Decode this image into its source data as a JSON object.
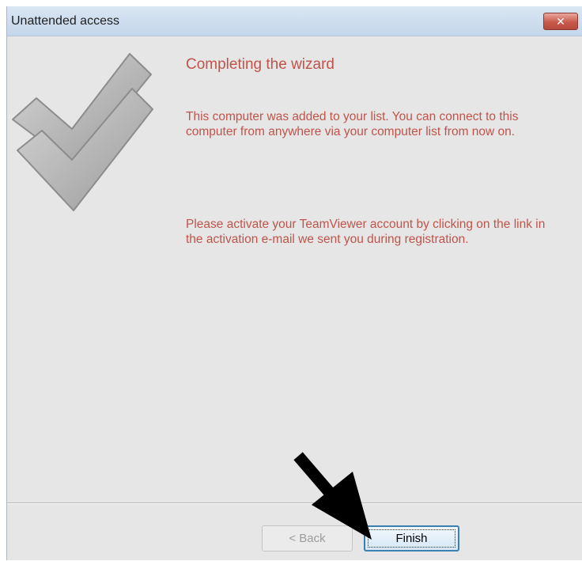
{
  "window": {
    "title": "Unattended access",
    "close_glyph": "✕"
  },
  "main": {
    "heading": "Completing the wizard",
    "paragraph_1": "This computer was added to your list. You can connect to this computer from anywhere via your computer list from now on.",
    "paragraph_2": "Please activate your TeamViewer account by clicking on the link in the activation e-mail we sent you during registration.",
    "illustration": "checkmark-icon"
  },
  "footer": {
    "back_label": "< Back",
    "finish_label": "Finish",
    "back_enabled": false,
    "finish_focused": true
  },
  "annotation": {
    "icon": "pointer-arrow-icon"
  },
  "colors": {
    "text_accent": "#c0544a",
    "dialog_bg": "#e6e6e6",
    "titlebar": "#c4d6ea",
    "close_button": "#c85a4c"
  }
}
